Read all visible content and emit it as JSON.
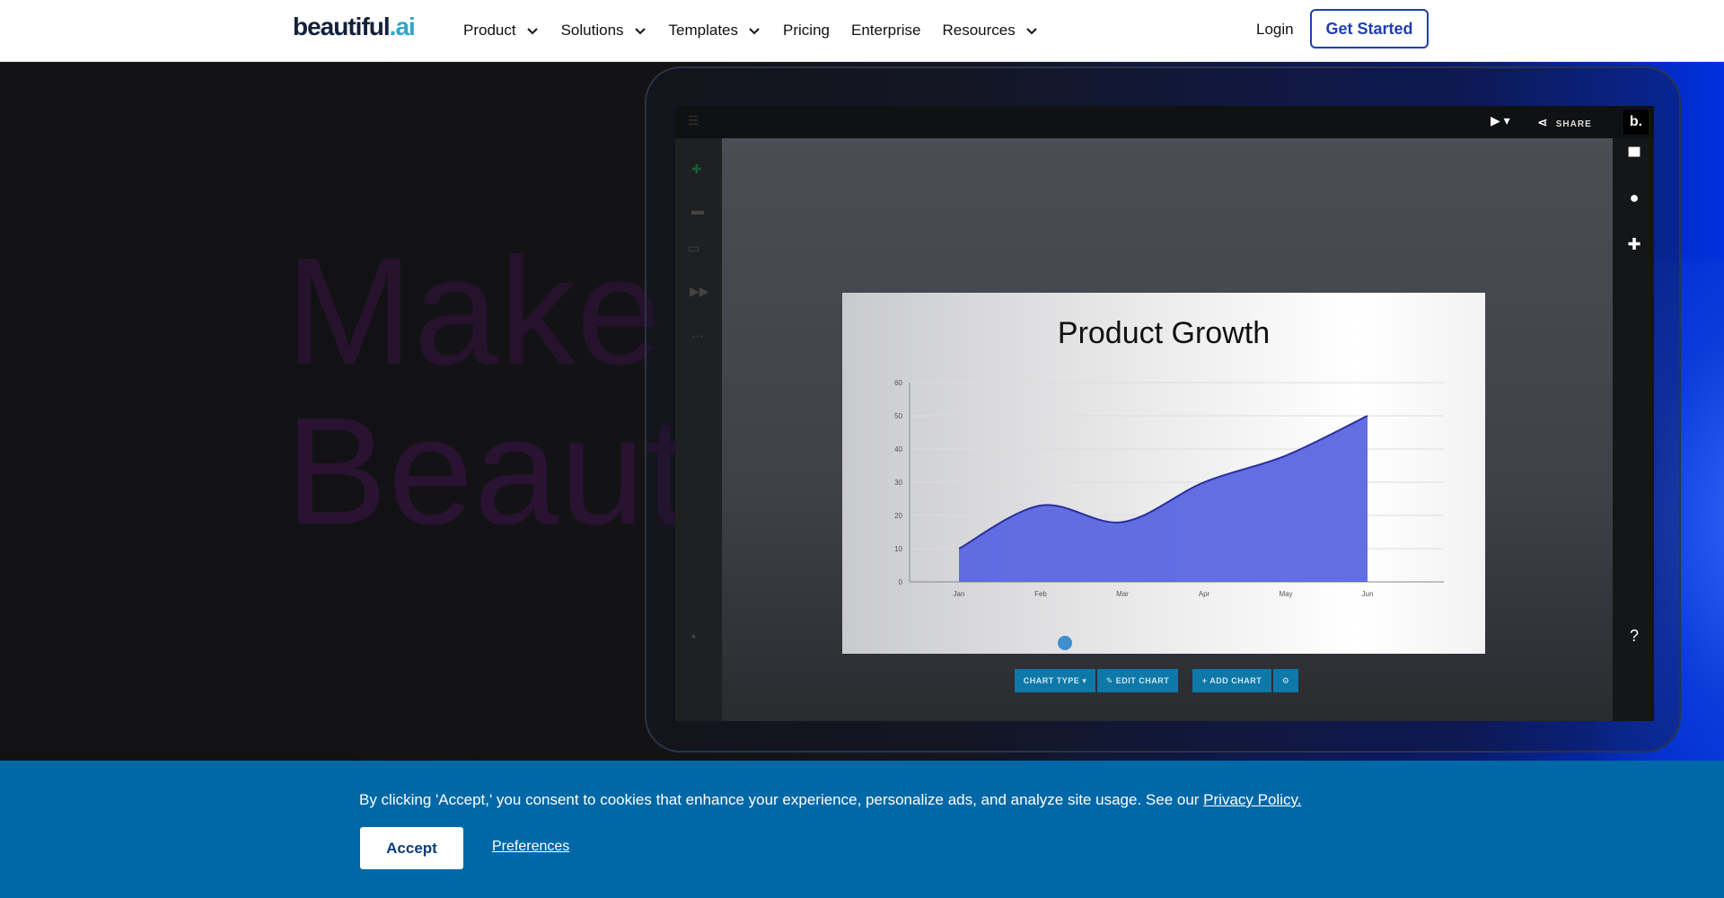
{
  "nav": {
    "logo": "beautiful",
    "logo_suffix": ".ai",
    "items": [
      {
        "label": "Product",
        "dropdown": true
      },
      {
        "label": "Solutions",
        "dropdown": true
      },
      {
        "label": "Templates",
        "dropdown": true
      },
      {
        "label": "Pricing",
        "dropdown": false
      },
      {
        "label": "Enterprise",
        "dropdown": false
      },
      {
        "label": "Resources",
        "dropdown": true
      }
    ],
    "login": "Login",
    "cta": "Get Started"
  },
  "hero": {
    "line1": "Make it",
    "line2": "Beautiful"
  },
  "app": {
    "share_label": "SHARE",
    "brand_badge": "b.",
    "slide_title": "Product Growth",
    "toolbar": {
      "chart_type": "CHART TYPE ▾",
      "edit_chart": "✎  EDIT CHART",
      "add_chart": "+  ADD CHART"
    }
  },
  "chart_data": {
    "type": "area",
    "title": "Product Growth",
    "categories": [
      "Jan",
      "Feb",
      "Mar",
      "Apr",
      "May",
      "Jun"
    ],
    "values": [
      10,
      23,
      18,
      30,
      38,
      50
    ],
    "ylim": [
      0,
      60
    ],
    "yticks": [
      0,
      10,
      20,
      30,
      40,
      50,
      60
    ],
    "grid": true,
    "color": "#5a66e0"
  },
  "cookie": {
    "text": "By clicking 'Accept,' you consent to cookies that enhance your experience, personalize ads, and analyze site usage. See our ",
    "privacy_link": "Privacy Policy.",
    "accept": "Accept",
    "preferences": "Preferences"
  },
  "colors": {
    "brand_blue": "#1f3fae",
    "cookie_bg": "#0068a6",
    "chart_fill": "#5a66e0"
  }
}
